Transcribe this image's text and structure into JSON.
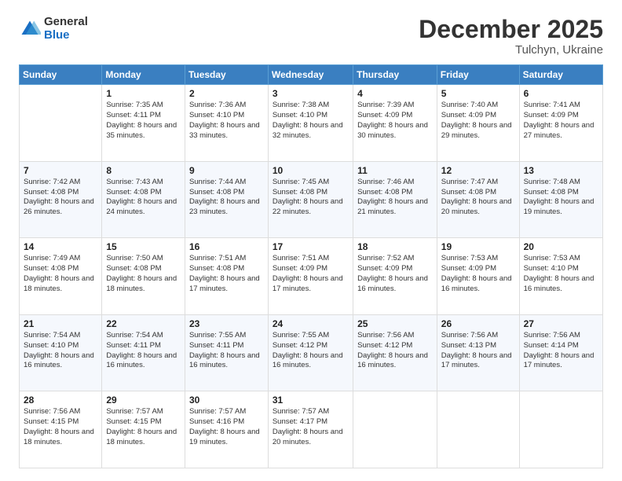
{
  "logo": {
    "general": "General",
    "blue": "Blue"
  },
  "header": {
    "month": "December 2025",
    "location": "Tulchyn, Ukraine"
  },
  "weekdays": [
    "Sunday",
    "Monday",
    "Tuesday",
    "Wednesday",
    "Thursday",
    "Friday",
    "Saturday"
  ],
  "weeks": [
    [
      {
        "day": "",
        "info": ""
      },
      {
        "day": "1",
        "info": "Sunrise: 7:35 AM\nSunset: 4:11 PM\nDaylight: 8 hours\nand 35 minutes."
      },
      {
        "day": "2",
        "info": "Sunrise: 7:36 AM\nSunset: 4:10 PM\nDaylight: 8 hours\nand 33 minutes."
      },
      {
        "day": "3",
        "info": "Sunrise: 7:38 AM\nSunset: 4:10 PM\nDaylight: 8 hours\nand 32 minutes."
      },
      {
        "day": "4",
        "info": "Sunrise: 7:39 AM\nSunset: 4:09 PM\nDaylight: 8 hours\nand 30 minutes."
      },
      {
        "day": "5",
        "info": "Sunrise: 7:40 AM\nSunset: 4:09 PM\nDaylight: 8 hours\nand 29 minutes."
      },
      {
        "day": "6",
        "info": "Sunrise: 7:41 AM\nSunset: 4:09 PM\nDaylight: 8 hours\nand 27 minutes."
      }
    ],
    [
      {
        "day": "7",
        "info": "Sunrise: 7:42 AM\nSunset: 4:08 PM\nDaylight: 8 hours\nand 26 minutes."
      },
      {
        "day": "8",
        "info": "Sunrise: 7:43 AM\nSunset: 4:08 PM\nDaylight: 8 hours\nand 24 minutes."
      },
      {
        "day": "9",
        "info": "Sunrise: 7:44 AM\nSunset: 4:08 PM\nDaylight: 8 hours\nand 23 minutes."
      },
      {
        "day": "10",
        "info": "Sunrise: 7:45 AM\nSunset: 4:08 PM\nDaylight: 8 hours\nand 22 minutes."
      },
      {
        "day": "11",
        "info": "Sunrise: 7:46 AM\nSunset: 4:08 PM\nDaylight: 8 hours\nand 21 minutes."
      },
      {
        "day": "12",
        "info": "Sunrise: 7:47 AM\nSunset: 4:08 PM\nDaylight: 8 hours\nand 20 minutes."
      },
      {
        "day": "13",
        "info": "Sunrise: 7:48 AM\nSunset: 4:08 PM\nDaylight: 8 hours\nand 19 minutes."
      }
    ],
    [
      {
        "day": "14",
        "info": "Sunrise: 7:49 AM\nSunset: 4:08 PM\nDaylight: 8 hours\nand 18 minutes."
      },
      {
        "day": "15",
        "info": "Sunrise: 7:50 AM\nSunset: 4:08 PM\nDaylight: 8 hours\nand 18 minutes."
      },
      {
        "day": "16",
        "info": "Sunrise: 7:51 AM\nSunset: 4:08 PM\nDaylight: 8 hours\nand 17 minutes."
      },
      {
        "day": "17",
        "info": "Sunrise: 7:51 AM\nSunset: 4:09 PM\nDaylight: 8 hours\nand 17 minutes."
      },
      {
        "day": "18",
        "info": "Sunrise: 7:52 AM\nSunset: 4:09 PM\nDaylight: 8 hours\nand 16 minutes."
      },
      {
        "day": "19",
        "info": "Sunrise: 7:53 AM\nSunset: 4:09 PM\nDaylight: 8 hours\nand 16 minutes."
      },
      {
        "day": "20",
        "info": "Sunrise: 7:53 AM\nSunset: 4:10 PM\nDaylight: 8 hours\nand 16 minutes."
      }
    ],
    [
      {
        "day": "21",
        "info": "Sunrise: 7:54 AM\nSunset: 4:10 PM\nDaylight: 8 hours\nand 16 minutes."
      },
      {
        "day": "22",
        "info": "Sunrise: 7:54 AM\nSunset: 4:11 PM\nDaylight: 8 hours\nand 16 minutes."
      },
      {
        "day": "23",
        "info": "Sunrise: 7:55 AM\nSunset: 4:11 PM\nDaylight: 8 hours\nand 16 minutes."
      },
      {
        "day": "24",
        "info": "Sunrise: 7:55 AM\nSunset: 4:12 PM\nDaylight: 8 hours\nand 16 minutes."
      },
      {
        "day": "25",
        "info": "Sunrise: 7:56 AM\nSunset: 4:12 PM\nDaylight: 8 hours\nand 16 minutes."
      },
      {
        "day": "26",
        "info": "Sunrise: 7:56 AM\nSunset: 4:13 PM\nDaylight: 8 hours\nand 17 minutes."
      },
      {
        "day": "27",
        "info": "Sunrise: 7:56 AM\nSunset: 4:14 PM\nDaylight: 8 hours\nand 17 minutes."
      }
    ],
    [
      {
        "day": "28",
        "info": "Sunrise: 7:56 AM\nSunset: 4:15 PM\nDaylight: 8 hours\nand 18 minutes."
      },
      {
        "day": "29",
        "info": "Sunrise: 7:57 AM\nSunset: 4:15 PM\nDaylight: 8 hours\nand 18 minutes."
      },
      {
        "day": "30",
        "info": "Sunrise: 7:57 AM\nSunset: 4:16 PM\nDaylight: 8 hours\nand 19 minutes."
      },
      {
        "day": "31",
        "info": "Sunrise: 7:57 AM\nSunset: 4:17 PM\nDaylight: 8 hours\nand 20 minutes."
      },
      {
        "day": "",
        "info": ""
      },
      {
        "day": "",
        "info": ""
      },
      {
        "day": "",
        "info": ""
      }
    ]
  ]
}
